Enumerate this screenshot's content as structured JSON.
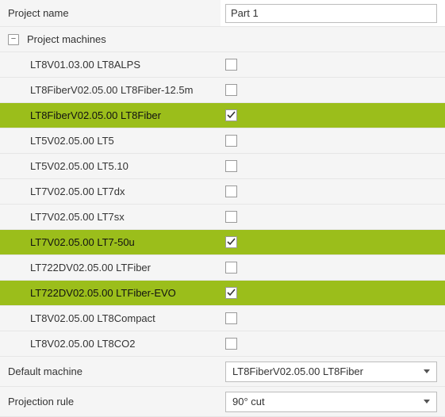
{
  "labels": {
    "project_name": "Project name",
    "project_machines": "Project machines",
    "default_machine": "Default machine",
    "projection_rule": "Projection rule"
  },
  "values": {
    "project_name": "Part 1",
    "default_machine": "LT8FiberV02.05.00 LT8Fiber",
    "projection_rule": "90° cut"
  },
  "machines": [
    {
      "name": "LT8V01.03.00 LT8ALPS",
      "checked": false,
      "selected": false
    },
    {
      "name": "LT8FiberV02.05.00 LT8Fiber-12.5m",
      "checked": false,
      "selected": false
    },
    {
      "name": "LT8FiberV02.05.00 LT8Fiber",
      "checked": true,
      "selected": true
    },
    {
      "name": "LT5V02.05.00 LT5",
      "checked": false,
      "selected": false
    },
    {
      "name": "LT5V02.05.00 LT5.10",
      "checked": false,
      "selected": false
    },
    {
      "name": "LT7V02.05.00 LT7dx",
      "checked": false,
      "selected": false
    },
    {
      "name": "LT7V02.05.00 LT7sx",
      "checked": false,
      "selected": false
    },
    {
      "name": "LT7V02.05.00 LT7-50u",
      "checked": true,
      "selected": true
    },
    {
      "name": "LT722DV02.05.00 LTFiber",
      "checked": false,
      "selected": false
    },
    {
      "name": "LT722DV02.05.00 LTFiber-EVO",
      "checked": true,
      "selected": true
    },
    {
      "name": "LT8V02.05.00 LT8Compact",
      "checked": false,
      "selected": false
    },
    {
      "name": "LT8V02.05.00 LT8CO2",
      "checked": false,
      "selected": false
    }
  ],
  "icons": {
    "collapse_glyph": "−"
  },
  "colors": {
    "highlight": "#9bbe1b"
  }
}
